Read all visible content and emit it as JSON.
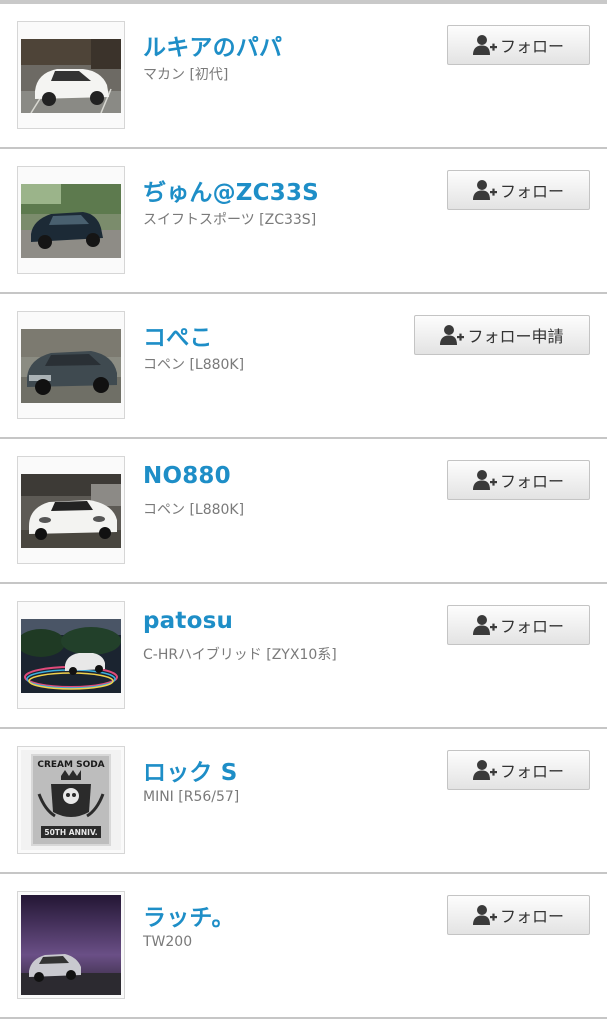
{
  "follow_label": "フォロー",
  "users": [
    {
      "name": "ルキアのパパ",
      "car": "マカン [初代]",
      "button": "フォロー",
      "icon": "person-add-icon"
    },
    {
      "name": "ぢゅん@ZC33S",
      "car": "スイフトスポーツ [ZC33S]",
      "button": "フォロー",
      "icon": "person-add-icon"
    },
    {
      "name": "コぺこ",
      "car": "コペン [L880K]",
      "button": "フォロー申請",
      "icon": "person-add-icon"
    },
    {
      "name": "NO880",
      "car": "コペン [L880K]",
      "button": "フォロー",
      "icon": "person-add-icon"
    },
    {
      "name": "patosu",
      "car": "C-HRハイブリッド [ZYX10系]",
      "button": "フォロー",
      "icon": "person-add-icon"
    },
    {
      "name": "ロック S",
      "car": "MINI [R56/57]",
      "button": "フォロー",
      "icon": "person-add-icon"
    },
    {
      "name": "ラッチ。",
      "car": "TW200",
      "button": "フォロー",
      "icon": "person-add-icon"
    }
  ],
  "badge": {
    "line1": "CREAM SODA",
    "line2": "50TH ANNIV."
  }
}
